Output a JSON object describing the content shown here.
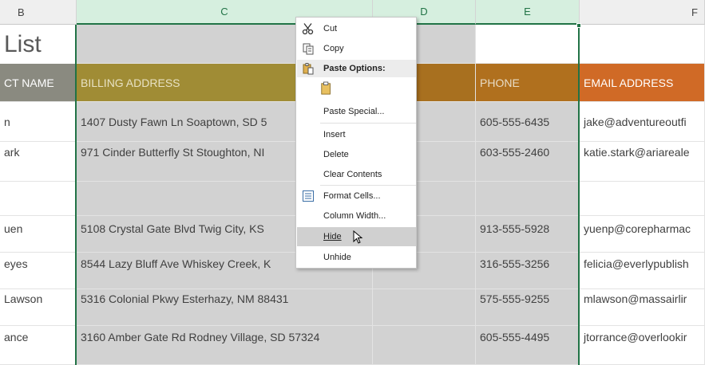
{
  "columns": [
    "B",
    "C",
    "D",
    "E",
    "F"
  ],
  "title": "List",
  "header": {
    "contact": "CT NAME",
    "billing": "BILLING ADDRESS",
    "phone": "PHONE",
    "email": "EMAIL ADDRESS"
  },
  "rows": [
    {
      "name": "n",
      "address": "1407 Dusty Fawn Ln Soaptown, SD 5",
      "phone": "605-555-6435",
      "email": "jake@adventureoutfi"
    },
    {
      "name": "ark",
      "address": "971 Cinder Butterfly St Stoughton, NI",
      "phone": "603-555-2460",
      "email": "katie.stark@ariareale"
    },
    {
      "name": "",
      "address": "",
      "phone": "",
      "email": ""
    },
    {
      "name": "uen",
      "address": "5108 Crystal Gate Blvd Twig City, KS",
      "phone": "913-555-5928",
      "email": "yuenp@corepharmac"
    },
    {
      "name": "eyes",
      "address": "8544 Lazy Bluff Ave Whiskey Creek, K",
      "phone": "316-555-3256",
      "email": "felicia@everlypublish"
    },
    {
      "name": "Lawson",
      "address": "5316 Colonial Pkwy Esterhazy, NM 88431",
      "phone": "575-555-9255",
      "email": "mlawson@massairlir"
    },
    {
      "name": "ance",
      "address": "3160 Amber Gate Rd Rodney Village, SD 57324",
      "phone": "605-555-4495",
      "email": "jtorrance@overlookir"
    }
  ],
  "menu": {
    "cut": "Cut",
    "copy": "Copy",
    "paste_options": "Paste Options:",
    "paste_special": "Paste Special...",
    "insert": "Insert",
    "delete": "Delete",
    "clear_contents": "Clear Contents",
    "format_cells": "Format Cells...",
    "column_width": "Column Width...",
    "hide": "Hide",
    "unhide": "Unhide"
  },
  "colors": {
    "header_olive": "#a08c35",
    "header_brown": "#a8701f",
    "header_orange": "#d06a26",
    "selection_green": "#217346"
  }
}
